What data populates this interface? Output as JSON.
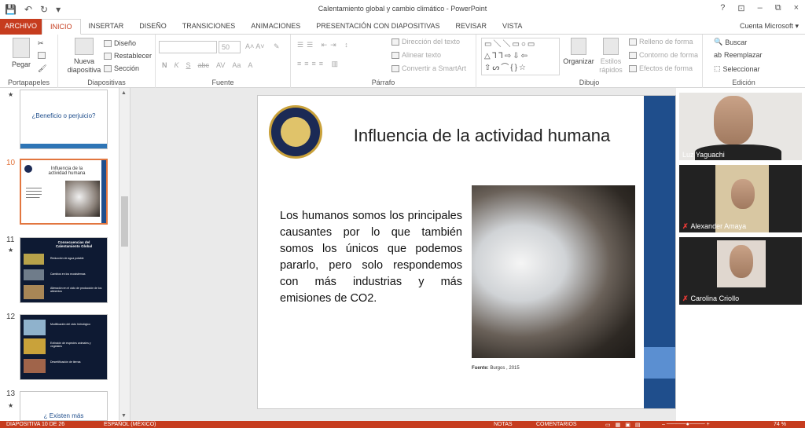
{
  "window": {
    "title": "Calentamiento global y cambio climático - PowerPoint",
    "controls": [
      "?",
      "⊡",
      "–",
      "⧉",
      "×"
    ]
  },
  "qat": {
    "save": "💾",
    "undo": "↶",
    "redo": "↻",
    "customize": "▾"
  },
  "tabs": [
    "ARCHIVO",
    "INICIO",
    "INSERTAR",
    "DISEÑO",
    "TRANSICIONES",
    "ANIMACIONES",
    "PRESENTACIÓN CON DIAPOSITIVAS",
    "REVISAR",
    "VISTA"
  ],
  "active_tab": "INICIO",
  "account": "Cuenta Microsoft ▾",
  "ribbon": {
    "clipboard": {
      "paste": "Pegar",
      "label": "Portapapeles"
    },
    "slides": {
      "new_slide": "Nueva diapositiva",
      "layout": "Diseño",
      "reset": "Restablecer",
      "section": "Sección",
      "label": "Diapositivas"
    },
    "font": {
      "font_size": "50",
      "label": "Fuente",
      "buttons": [
        "N",
        "K",
        "S",
        "abc",
        "AV",
        "Aa",
        "A"
      ]
    },
    "paragraph": {
      "text_direction": "Dirección del texto",
      "align_text": "Alinear texto",
      "smartart": "Convertir a SmartArt",
      "label": "Párrafo"
    },
    "drawing": {
      "arrange": "Organizar",
      "quick_styles": "Estilos rápidos",
      "shape_fill": "Relleno de forma",
      "shape_outline": "Contorno de forma",
      "shape_effects": "Efectos de forma",
      "label": "Dibujo"
    },
    "editing": {
      "find": "Buscar",
      "replace": "Reemplazar",
      "select": "Seleccionar",
      "label": "Edición"
    }
  },
  "thumbnails": [
    {
      "num": "",
      "title": "¿Beneficio o perjuicio?"
    },
    {
      "num": "10",
      "title": "Influencia de la actividad humana"
    },
    {
      "num": "11",
      "title": "Consecuencias del Calentamiento Global",
      "items": [
        "Reducción de agua potable",
        "Cambios en los ecosistemas",
        "Alteración en el ciclo de producción de los alimentos"
      ]
    },
    {
      "num": "12",
      "items": [
        "Modificación del ciclo hidrológico",
        "Extinción de especies animales y vegetales",
        "Desertificación de tierras"
      ]
    },
    {
      "num": "13",
      "title": "¿ Existen más"
    }
  ],
  "slide": {
    "title": "Influencia de la actividad humana",
    "body": "Los humanos somos los principales causantes por lo que también somos los únicos que podemos pararlo, pero solo respondemos con más industrias y más emisiones de CO2.",
    "source_label": "Fuente:",
    "source": "Burgos , 2015"
  },
  "participants": [
    {
      "name": "Luz Yaguachi",
      "muted": false
    },
    {
      "name": "Alexander Amaya",
      "muted": true
    },
    {
      "name": "Carolina Criollo",
      "muted": true
    }
  ],
  "status": {
    "slide": "DIAPOSITIVA 10 DE 26",
    "language": "ESPAÑOL (MÉXICO)",
    "notes": "NOTAS",
    "comments": "COMENTARIOS",
    "zoom": "74 %"
  }
}
